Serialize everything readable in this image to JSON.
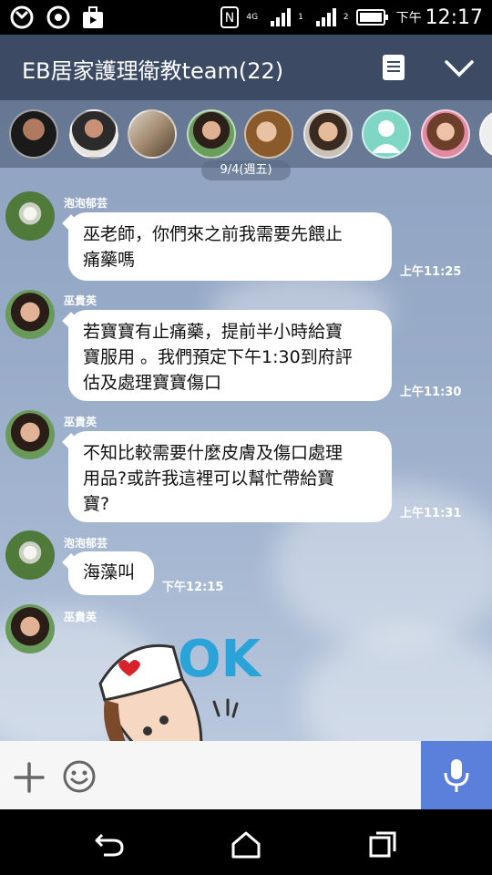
{
  "status_bar": {
    "ampm": "下午",
    "time": "12:17",
    "network": "4G",
    "sim1": "1",
    "sim2": "2"
  },
  "header": {
    "title": "EB居家護理衛教team(22)",
    "notes_icon": "notes-icon",
    "collapse_icon": "chevron-down-icon"
  },
  "date_divider": "9/4(週五)",
  "messages": [
    {
      "sender": "泡泡郁芸",
      "lines": [
        "巫老師，你們來之前我需要先餵止",
        "痛藥嗎"
      ],
      "time": "上午11:25"
    },
    {
      "sender": "巫貴英",
      "lines": [
        "若寶寶有止痛藥，提前半小時給寶",
        "寶服用 。我們預定下午1:30到府評",
        "估及處理寶寶傷口"
      ],
      "time": "上午11:30"
    },
    {
      "sender": "巫貴英",
      "lines": [
        "不知比較需要什麼皮膚及傷口處理",
        "用品?或許我這裡可以幫忙帶給寶",
        "寶?"
      ],
      "time": "上午11:31"
    },
    {
      "sender": "泡泡郁芸",
      "lines": [
        "海藻叫"
      ],
      "time": "下午12:15"
    },
    {
      "sender": "巫貴英",
      "sticker_text": "OK"
    }
  ],
  "input": {
    "value": "",
    "plus_icon": "plus-icon",
    "emoji_icon": "emoji-icon",
    "mic_icon": "microphone-icon"
  },
  "colors": {
    "header": "#3c4a63",
    "mic_button": "#5b80db",
    "bubble": "#ffffff"
  }
}
